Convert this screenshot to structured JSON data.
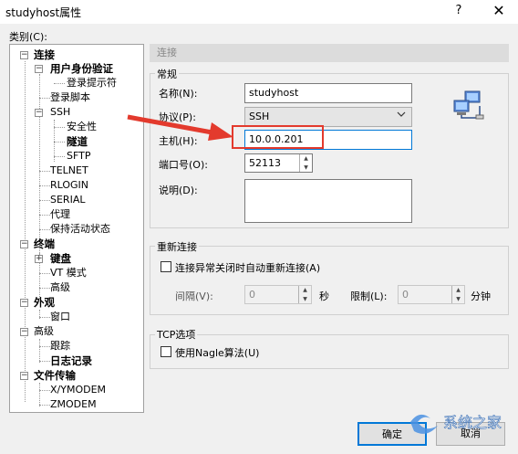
{
  "window": {
    "title": "studyhost属性",
    "help": "?",
    "close": "✕"
  },
  "category_label": "类别(C):",
  "tree": {
    "connection": "连接",
    "user_auth": "用户身份验证",
    "login_prompt": "登录提示符",
    "login_script": "登录脚本",
    "ssh": "SSH",
    "security": "安全性",
    "tunnel": "隧道",
    "sftp": "SFTP",
    "telnet": "TELNET",
    "rlogin": "RLOGIN",
    "serial": "SERIAL",
    "proxy": "代理",
    "keepalive": "保持活动状态",
    "terminal": "终端",
    "keyboard": "键盘",
    "vt_mode": "VT 模式",
    "advanced": "高级",
    "appearance": "外观",
    "window": "窗口",
    "advanced2": "高级",
    "trace": "跟踪",
    "logging": "日志记录",
    "file_transfer": "文件传输",
    "xymodem": "X/YMODEM",
    "zmodem": "ZMODEM"
  },
  "section_header": "连接",
  "general": {
    "title": "常规",
    "name_label": "名称(N):",
    "name_value": "studyhost",
    "protocol_label": "协议(P):",
    "protocol_value": "SSH",
    "host_label": "主机(H):",
    "host_value": "10.0.0.201",
    "port_label": "端口号(O):",
    "port_value": "52113",
    "desc_label": "说明(D):",
    "desc_value": ""
  },
  "reconnect": {
    "title": "重新连接",
    "checkbox_label": "连接异常关闭时自动重新连接(A)",
    "interval_label": "间隔(V):",
    "interval_value": "0",
    "seconds": "秒",
    "limit_label": "限制(L):",
    "limit_value": "0",
    "minutes": "分钟"
  },
  "tcp": {
    "title": "TCP选项",
    "nagle_label": "使用Nagle算法(U)"
  },
  "buttons": {
    "ok": "确定",
    "cancel": "取消"
  },
  "watermark": "系统之家",
  "colors": {
    "highlight": "#e33a2d",
    "accent": "#0078d7"
  }
}
